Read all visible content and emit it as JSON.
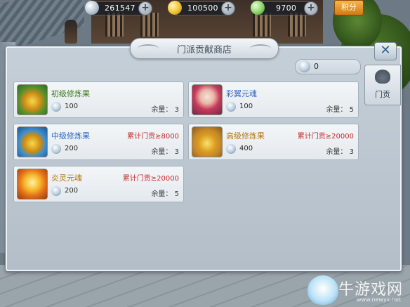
{
  "currency": {
    "silver": "261547",
    "gold": "100500",
    "jade": "9700",
    "points_label": "积分"
  },
  "shop": {
    "title": "门派贡献商店",
    "balance": "0",
    "side_tab_label": "门贡",
    "stock_label": "余量："
  },
  "items": [
    {
      "name": "初级修炼果",
      "price": "100",
      "stock": "3",
      "requirement": "",
      "color": "#3a7a18"
    },
    {
      "name": "彩翼元魂",
      "price": "100",
      "stock": "5",
      "requirement": "",
      "color": "#2b66c6"
    },
    {
      "name": "中级修炼果",
      "price": "200",
      "stock": "3",
      "requirement": "累计门贡≥8000",
      "color": "#2b66c6"
    },
    {
      "name": "高级修炼果",
      "price": "400",
      "stock": "3",
      "requirement": "累计门贡≥20000",
      "color": "#b8770c"
    },
    {
      "name": "炎灵元魂",
      "price": "200",
      "stock": "5",
      "requirement": "累计门贡≥20000",
      "color": "#b8770c"
    }
  ],
  "watermark": {
    "text": "牛游戏网",
    "url": "www.newyx.net"
  }
}
